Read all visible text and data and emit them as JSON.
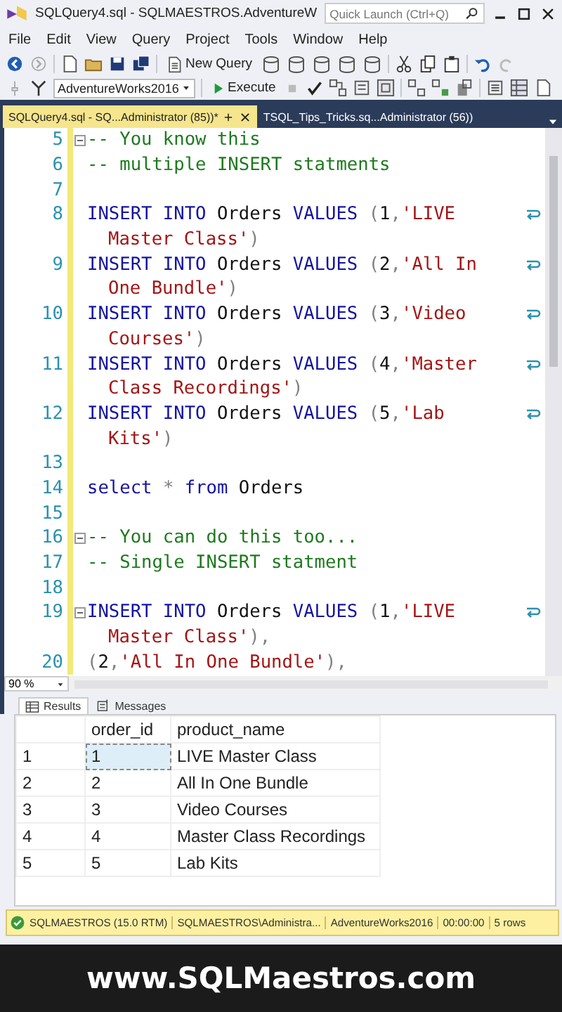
{
  "window": {
    "title": "SQLQuery4.sql - SQLMAESTROS.AdventureW",
    "quick_launch": {
      "placeholder": "Quick Launch (Ctrl+Q)"
    }
  },
  "menu": [
    "File",
    "Edit",
    "View",
    "Query",
    "Project",
    "Tools",
    "Window",
    "Help"
  ],
  "toolbar": {
    "new_query": "New Query",
    "database": "AdventureWorks2016",
    "execute": "Execute"
  },
  "tabs": [
    {
      "label": "SQLQuery4.sql - SQ...Administrator (85))*",
      "selected": true
    },
    {
      "label": "TSQL_Tips_Tricks.sq...Administrator (56))",
      "selected": false
    }
  ],
  "editor": {
    "lines": [
      {
        "number": "5",
        "fold": true,
        "wrapped": false,
        "rows": [
          {
            "segments": [
              {
                "kind": "comment",
                "text": "-- You know this"
              }
            ]
          }
        ]
      },
      {
        "number": "6",
        "fold": false,
        "wrapped": false,
        "rows": [
          {
            "segments": [
              {
                "kind": "comment",
                "text": "-- multiple INSERT statments"
              }
            ]
          }
        ]
      },
      {
        "number": "7",
        "fold": false,
        "wrapped": false
      },
      {
        "number": "8",
        "fold": false,
        "wrapped": true,
        "rows": [
          {
            "segments": [
              {
                "kind": "keyword",
                "text": "INSERT INTO"
              },
              {
                "kind": "plain",
                "text": " Orders "
              },
              {
                "kind": "keyword",
                "text": "VALUES"
              },
              {
                "kind": "punct",
                "text": " ("
              },
              {
                "kind": "plain",
                "text": "1"
              },
              {
                "kind": "punct",
                "text": ","
              },
              {
                "kind": "string",
                "text": "'LIVE"
              }
            ]
          },
          {
            "segments": [
              {
                "kind": "string",
                "text": "Master Class'"
              },
              {
                "kind": "punct",
                "text": ")"
              }
            ]
          }
        ]
      },
      {
        "number": "9",
        "fold": false,
        "wrapped": true,
        "rows": [
          {
            "segments": [
              {
                "kind": "keyword",
                "text": "INSERT INTO"
              },
              {
                "kind": "plain",
                "text": " Orders "
              },
              {
                "kind": "keyword",
                "text": "VALUES"
              },
              {
                "kind": "punct",
                "text": " ("
              },
              {
                "kind": "plain",
                "text": "2"
              },
              {
                "kind": "punct",
                "text": ","
              },
              {
                "kind": "string",
                "text": "'All In"
              }
            ]
          },
          {
            "segments": [
              {
                "kind": "string",
                "text": "One Bundle'"
              },
              {
                "kind": "punct",
                "text": ")"
              }
            ]
          }
        ]
      },
      {
        "number": "10",
        "fold": false,
        "wrapped": true,
        "rows": [
          {
            "segments": [
              {
                "kind": "keyword",
                "text": "INSERT INTO"
              },
              {
                "kind": "plain",
                "text": " Orders "
              },
              {
                "kind": "keyword",
                "text": "VALUES"
              },
              {
                "kind": "punct",
                "text": " ("
              },
              {
                "kind": "plain",
                "text": "3"
              },
              {
                "kind": "punct",
                "text": ","
              },
              {
                "kind": "string",
                "text": "'Video"
              }
            ]
          },
          {
            "segments": [
              {
                "kind": "string",
                "text": "Courses'"
              },
              {
                "kind": "punct",
                "text": ")"
              }
            ]
          }
        ]
      },
      {
        "number": "11",
        "fold": false,
        "wrapped": true,
        "rows": [
          {
            "segments": [
              {
                "kind": "keyword",
                "text": "INSERT INTO"
              },
              {
                "kind": "plain",
                "text": " Orders "
              },
              {
                "kind": "keyword",
                "text": "VALUES"
              },
              {
                "kind": "punct",
                "text": " ("
              },
              {
                "kind": "plain",
                "text": "4"
              },
              {
                "kind": "punct",
                "text": ","
              },
              {
                "kind": "string",
                "text": "'Master"
              }
            ]
          },
          {
            "segments": [
              {
                "kind": "string",
                "text": "Class Recordings'"
              },
              {
                "kind": "punct",
                "text": ")"
              }
            ]
          }
        ]
      },
      {
        "number": "12",
        "fold": false,
        "wrapped": true,
        "rows": [
          {
            "segments": [
              {
                "kind": "keyword",
                "text": "INSERT INTO"
              },
              {
                "kind": "plain",
                "text": " Orders "
              },
              {
                "kind": "keyword",
                "text": "VALUES"
              },
              {
                "kind": "punct",
                "text": " ("
              },
              {
                "kind": "plain",
                "text": "5"
              },
              {
                "kind": "punct",
                "text": ","
              },
              {
                "kind": "string",
                "text": "'Lab"
              }
            ]
          },
          {
            "segments": [
              {
                "kind": "string",
                "text": "Kits'"
              },
              {
                "kind": "punct",
                "text": ")"
              }
            ]
          }
        ]
      },
      {
        "number": "13",
        "fold": false,
        "wrapped": false
      },
      {
        "number": "14",
        "fold": false,
        "wrapped": false,
        "rows": [
          {
            "segments": [
              {
                "kind": "keyword",
                "text": "select"
              },
              {
                "kind": "punct",
                "text": " * "
              },
              {
                "kind": "keyword",
                "text": "from"
              },
              {
                "kind": "plain",
                "text": " Orders"
              }
            ]
          }
        ]
      },
      {
        "number": "15",
        "fold": false,
        "wrapped": false
      },
      {
        "number": "16",
        "fold": true,
        "wrapped": false,
        "rows": [
          {
            "segments": [
              {
                "kind": "comment",
                "text": "-- You can do this too..."
              }
            ]
          }
        ]
      },
      {
        "number": "17",
        "fold": false,
        "wrapped": false,
        "rows": [
          {
            "segments": [
              {
                "kind": "comment",
                "text": "-- Single INSERT statment"
              }
            ]
          }
        ]
      },
      {
        "number": "18",
        "fold": false,
        "wrapped": false
      },
      {
        "number": "19",
        "fold": true,
        "wrapped": true,
        "rows": [
          {
            "segments": [
              {
                "kind": "keyword",
                "text": "INSERT INTO"
              },
              {
                "kind": "plain",
                "text": " Orders "
              },
              {
                "kind": "keyword",
                "text": "VALUES"
              },
              {
                "kind": "punct",
                "text": " ("
              },
              {
                "kind": "plain",
                "text": "1"
              },
              {
                "kind": "punct",
                "text": ","
              },
              {
                "kind": "string",
                "text": "'LIVE"
              }
            ]
          },
          {
            "segments": [
              {
                "kind": "string",
                "text": "Master Class'"
              },
              {
                "kind": "punct",
                "text": "),"
              }
            ]
          }
        ]
      },
      {
        "number": "20",
        "fold": false,
        "wrapped": false,
        "rows": [
          {
            "segments": [
              {
                "kind": "punct",
                "text": "("
              },
              {
                "kind": "plain",
                "text": "2"
              },
              {
                "kind": "punct",
                "text": ","
              },
              {
                "kind": "string",
                "text": "'All In One Bundle'"
              },
              {
                "kind": "punct",
                "text": "),"
              }
            ]
          }
        ]
      }
    ],
    "zoom": "90 %"
  },
  "result_tabs": [
    {
      "label": "Results",
      "selected": true
    },
    {
      "label": "Messages",
      "selected": false
    }
  ],
  "grid": {
    "columns": [
      "order_id",
      "product_name"
    ],
    "rows": [
      {
        "number": "1",
        "cells": [
          "1",
          "LIVE Master Class"
        ],
        "selected": true
      },
      {
        "number": "2",
        "cells": [
          "2",
          "All In One Bundle"
        ],
        "selected": false
      },
      {
        "number": "3",
        "cells": [
          "3",
          "Video Courses"
        ],
        "selected": false
      },
      {
        "number": "4",
        "cells": [
          "4",
          "Master Class Recordings"
        ],
        "selected": false
      },
      {
        "number": "5",
        "cells": [
          "5",
          "Lab Kits"
        ],
        "selected": false
      }
    ]
  },
  "status_bar": [
    "SQLMAESTROS (15.0 RTM)",
    "SQLMAESTROS\\Administra...",
    "AdventureWorks2016",
    "00:00:00",
    "5 rows"
  ],
  "footer": "www.SQLMaestros.com"
}
